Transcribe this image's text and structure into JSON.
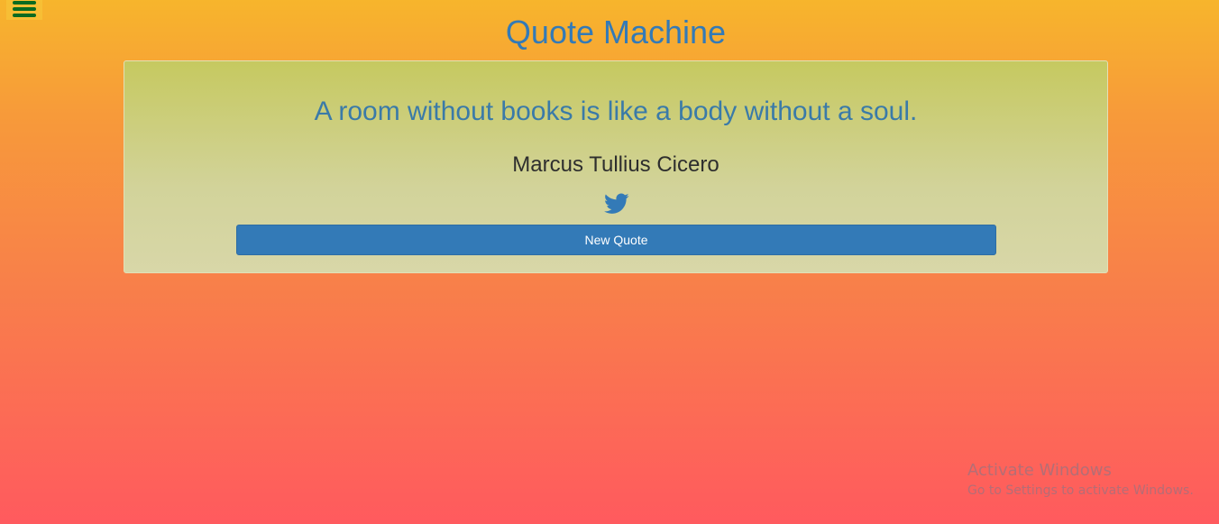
{
  "header": {
    "title": "Quote Machine",
    "menu_icon": "hamburger-menu-icon"
  },
  "quote": {
    "text": "A room without books is like a body without a soul.",
    "author": "Marcus Tullius Cicero",
    "tweet_icon": "twitter-bird-icon",
    "new_quote_label": "New Quote"
  },
  "watermark": {
    "title": "Activate Windows",
    "subtitle": "Go to Settings to activate Windows."
  },
  "colors": {
    "accent": "#337ab7",
    "menu_icon": "#0b6b20",
    "author_text": "#2e2e2e",
    "background_top": "#f7b52c",
    "background_bottom": "#ff5a5e"
  }
}
